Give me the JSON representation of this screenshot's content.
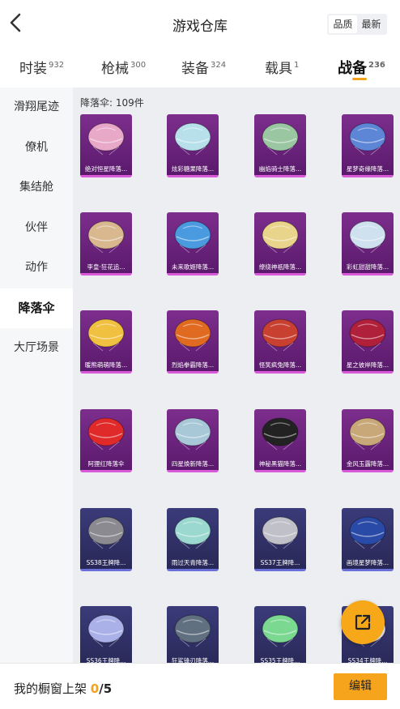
{
  "header": {
    "title": "游戏仓库",
    "sort_options": [
      "品质",
      "最新"
    ],
    "sort_selected": "品质"
  },
  "tabs": [
    {
      "label": "时装",
      "count": "932"
    },
    {
      "label": "枪械",
      "count": "300"
    },
    {
      "label": "装备",
      "count": "324"
    },
    {
      "label": "载具",
      "count": "1"
    },
    {
      "label": "战备",
      "count": "236",
      "active": true
    }
  ],
  "sidebar": {
    "items": [
      "滑翔尾迹",
      "僚机",
      "集结舱",
      "伙伴",
      "动作",
      "降落伞",
      "大厅场景"
    ],
    "active": "降落伞"
  },
  "content": {
    "count_label": "降落伞: 109件",
    "items": [
      {
        "name": "绝对恒星降落...",
        "tier": "purple",
        "color": "#e8a8c8"
      },
      {
        "name": "炫彩糖果降落...",
        "tier": "purple",
        "color": "#b8e0ea"
      },
      {
        "name": "幽焰骑士降落...",
        "tier": "purple",
        "color": "#9ac7a2"
      },
      {
        "name": "星梦奇缘降落...",
        "tier": "purple",
        "color": "#5e86d6"
      },
      {
        "name": "李皇·狂花追...",
        "tier": "purple",
        "color": "#d9b890"
      },
      {
        "name": "未来歌姬降落...",
        "tier": "purple",
        "color": "#4a9ae0"
      },
      {
        "name": "缭绕神祇降落...",
        "tier": "purple",
        "color": "#e8d48a"
      },
      {
        "name": "彩虹甜甜降落...",
        "tier": "purple",
        "color": "#cfe0ee"
      },
      {
        "name": "暖熊萌萌降落...",
        "tier": "purple",
        "color": "#f0c040"
      },
      {
        "name": "烈焰拳霸降落...",
        "tier": "purple",
        "color": "#e06a20"
      },
      {
        "name": "怪笑疯兔降落...",
        "tier": "purple",
        "color": "#c84030"
      },
      {
        "name": "星之彼岸降落...",
        "tier": "purple",
        "color": "#b0203a"
      },
      {
        "name": "阿狸红降落伞",
        "tier": "purple",
        "color": "#e02a2a"
      },
      {
        "name": "四星焕新降落...",
        "tier": "purple",
        "color": "#a8c8d8"
      },
      {
        "name": "神秘黑猫降落...",
        "tier": "purple",
        "color": "#222222"
      },
      {
        "name": "金风玉露降落...",
        "tier": "purple",
        "color": "#c8a878"
      },
      {
        "name": "SS38王牌降...",
        "tier": "blue",
        "color": "#8a8a90"
      },
      {
        "name": "雨过天青降落...",
        "tier": "blue",
        "color": "#9ad8d0"
      },
      {
        "name": "SS37王牌降...",
        "tier": "blue",
        "color": "#c0c0c8"
      },
      {
        "name": "画境星梦降落...",
        "tier": "blue",
        "color": "#2a4aa8"
      },
      {
        "name": "SS36王牌降...",
        "tier": "blue",
        "color": "#aab0e8"
      },
      {
        "name": "狂鲨锋刃降落...",
        "tier": "blue",
        "color": "#607080"
      },
      {
        "name": "SS35王牌降...",
        "tier": "blue",
        "color": "#7ad890"
      },
      {
        "name": "SS34王牌降...",
        "tier": "blue",
        "color": "#f0f0f0"
      }
    ]
  },
  "bottom_bar": {
    "label": "我的橱窗上架",
    "current": "0",
    "total": "/5",
    "edit_label": "编辑"
  },
  "colors": {
    "accent": "#f6a41c",
    "purple_card": "#6a2480",
    "blue_card": "#30306a"
  }
}
